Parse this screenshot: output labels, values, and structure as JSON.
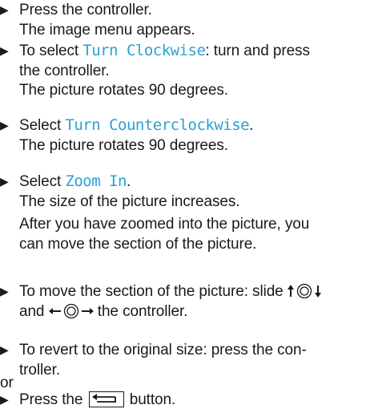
{
  "steps": [
    {
      "line1": "Press the controller.",
      "result": "The image menu appears."
    },
    {
      "prefix": "To select ",
      "term": "Turn Clockwise",
      "suffix": ": turn and press",
      "line2": "the controller.",
      "result": "The picture rotates 90 degrees."
    },
    {
      "prefix": "Select ",
      "term": "Turn Counterclockwise",
      "suffix": ".",
      "result": "The picture rotates 90 degrees."
    },
    {
      "prefix": "Select ",
      "term": "Zoom In",
      "suffix": ".",
      "result": "The size of the picture increases.",
      "note_line1": "After you have zoomed into the picture, you",
      "note_line2": "can move the section of the picture."
    },
    {
      "line1": "To move the section of the picture: slide",
      "line2_mid": "and",
      "line2_end": "the controller."
    },
    {
      "line1": "To revert to the original size: press the con-",
      "line2": "troller."
    }
  ],
  "or_label": "or",
  "last_step": {
    "prefix": "Press the",
    "suffix": "button."
  },
  "colors": {
    "ui_term": "#2aa0d6",
    "text": "#1a1a1a"
  },
  "icons": {
    "bullet": "triangle-right",
    "slide_vertical": "controller-slide-up-down",
    "slide_horizontal": "controller-slide-left-right",
    "back_button": "back-arrow-key"
  }
}
